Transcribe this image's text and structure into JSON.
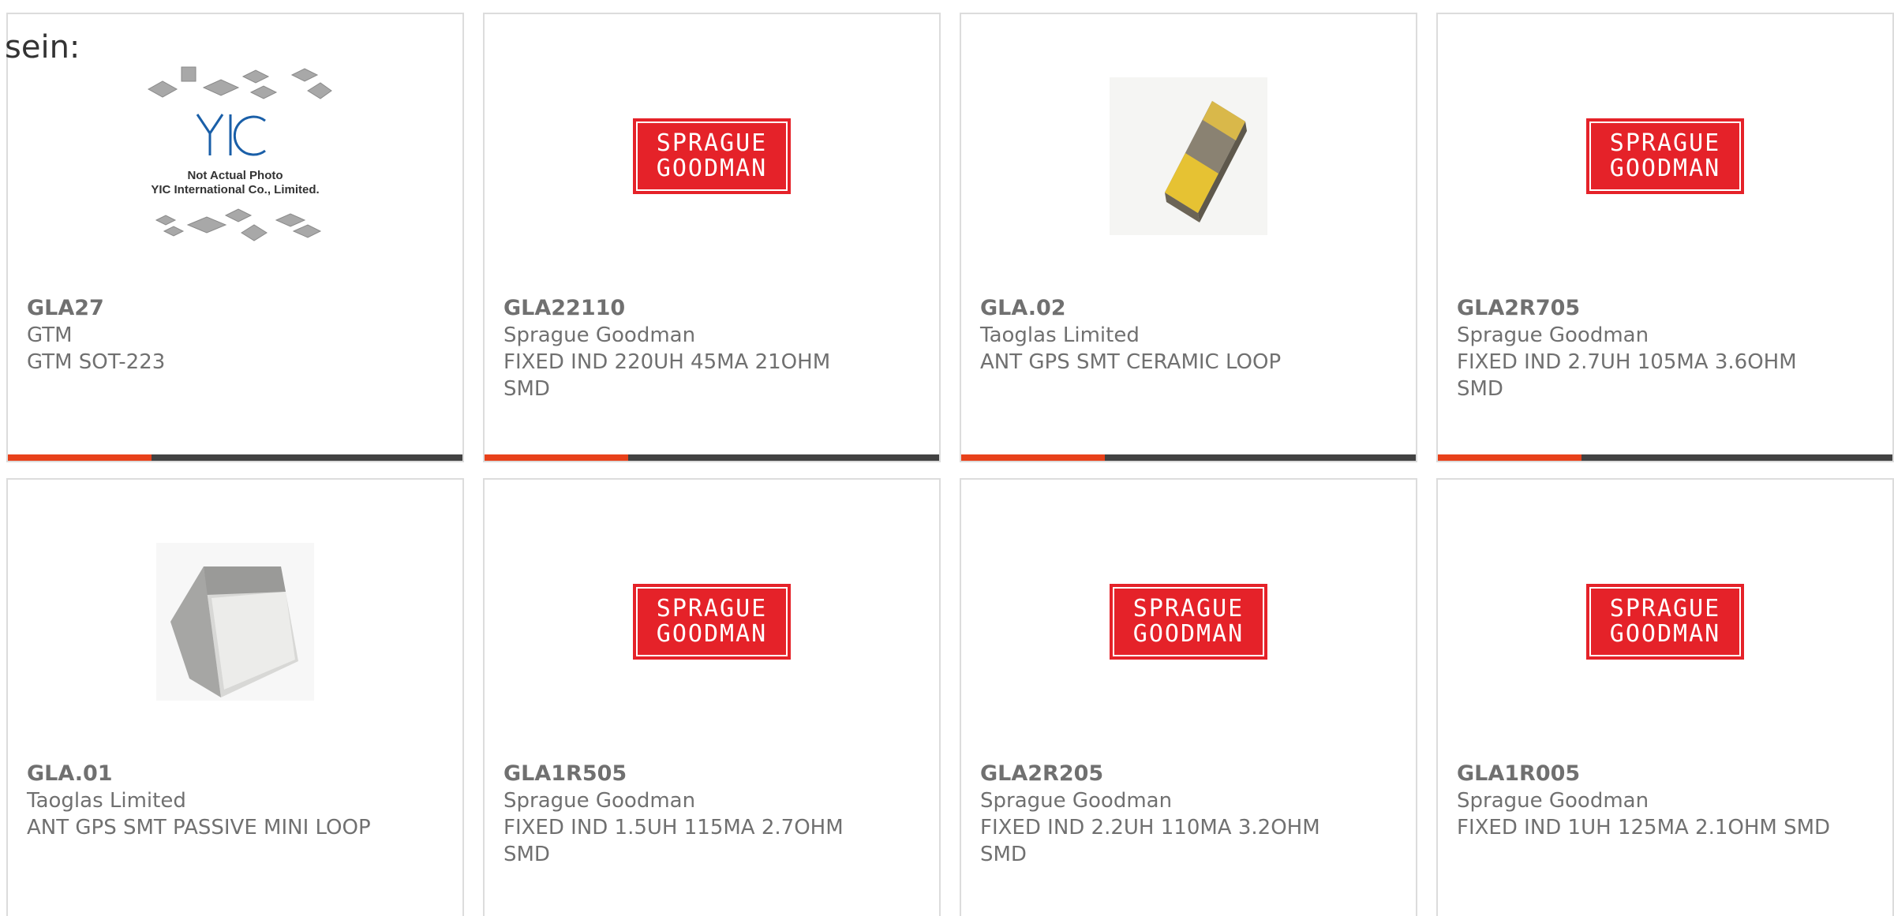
{
  "prefix_text": "sein:",
  "colors": {
    "accent": "#e8411a",
    "bar": "#424242",
    "text": "#707070",
    "card_border": "#dcdcdc",
    "sprague_red": "#e52229"
  },
  "cards": [
    {
      "part": "GLA27",
      "manufacturer": "GTM",
      "description": "GTM SOT-223",
      "image": "yic-not-actual-photo",
      "image_text": [
        "Not Actual Photo",
        "YIC International Co., Limited."
      ],
      "image_logo": "YIC"
    },
    {
      "part": "GLA22110",
      "manufacturer": "Sprague Goodman",
      "description": "FIXED IND 220UH 45MA 21OHM SMD",
      "image": "sprague-goodman-logo",
      "logo_lines": [
        "SPRAGUE",
        "GOODMAN"
      ]
    },
    {
      "part": "GLA.02",
      "manufacturer": "Taoglas Limited",
      "description": "ANT GPS SMT CERAMIC LOOP",
      "image": "gold-chip-antenna"
    },
    {
      "part": "GLA2R705",
      "manufacturer": "Sprague Goodman",
      "description": "FIXED IND 2.7UH 105MA 3.6OHM SMD",
      "image": "sprague-goodman-logo",
      "logo_lines": [
        "SPRAGUE",
        "GOODMAN"
      ]
    },
    {
      "part": "GLA.01",
      "manufacturer": "Taoglas Limited",
      "description": "ANT GPS SMT PASSIVE MINI LOOP",
      "image": "silver-chip-antenna"
    },
    {
      "part": "GLA1R505",
      "manufacturer": "Sprague Goodman",
      "description": "FIXED IND 1.5UH 115MA 2.7OHM SMD",
      "image": "sprague-goodman-logo",
      "logo_lines": [
        "SPRAGUE",
        "GOODMAN"
      ]
    },
    {
      "part": "GLA2R205",
      "manufacturer": "Sprague Goodman",
      "description": "FIXED IND 2.2UH 110MA 3.2OHM SMD",
      "image": "sprague-goodman-logo",
      "logo_lines": [
        "SPRAGUE",
        "GOODMAN"
      ]
    },
    {
      "part": "GLA1R005",
      "manufacturer": "Sprague Goodman",
      "description": "FIXED IND 1UH 125MA 2.1OHM SMD",
      "image": "sprague-goodman-logo",
      "logo_lines": [
        "SPRAGUE",
        "GOODMAN"
      ]
    }
  ]
}
